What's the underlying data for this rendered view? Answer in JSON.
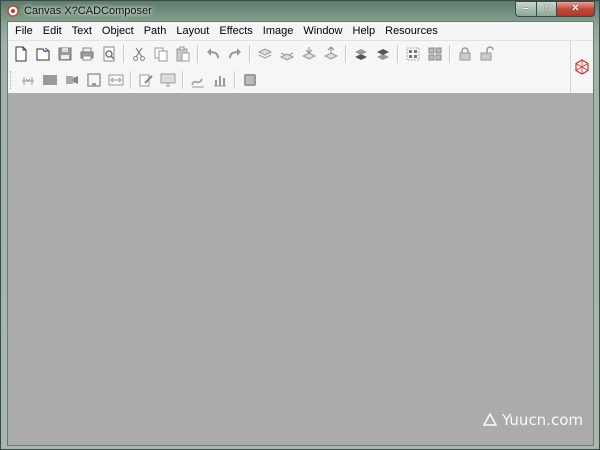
{
  "window": {
    "title": "Canvas X?CADComposer"
  },
  "controls": {
    "minimize": "‒",
    "maximize": "□",
    "close": "✕"
  },
  "menu": [
    "File",
    "Edit",
    "Text",
    "Object",
    "Path",
    "Layout",
    "Effects",
    "Image",
    "Window",
    "Help",
    "Resources"
  ],
  "toolbar1": [
    "new-document",
    "open-file",
    "save",
    "print",
    "print-preview",
    "cut",
    "copy",
    "paste",
    "undo",
    "redo",
    "layer-up",
    "layer-down",
    "layer-bring-forward",
    "layer-send-backward",
    "bring-to-front",
    "send-to-back",
    "group",
    "ungroup",
    "lock",
    "unlock"
  ],
  "toolbar2": [
    "dimension-line",
    "rectangle-fill",
    "transform-shape",
    "frame",
    "fit-width",
    "edit-note",
    "monitor-display",
    "curve-tool",
    "bar-chart",
    "object-box"
  ],
  "watermark": {
    "text": "Yuucn.com"
  },
  "colors": {
    "workspace": "#ababab",
    "accent_logo": "#d3362f"
  }
}
